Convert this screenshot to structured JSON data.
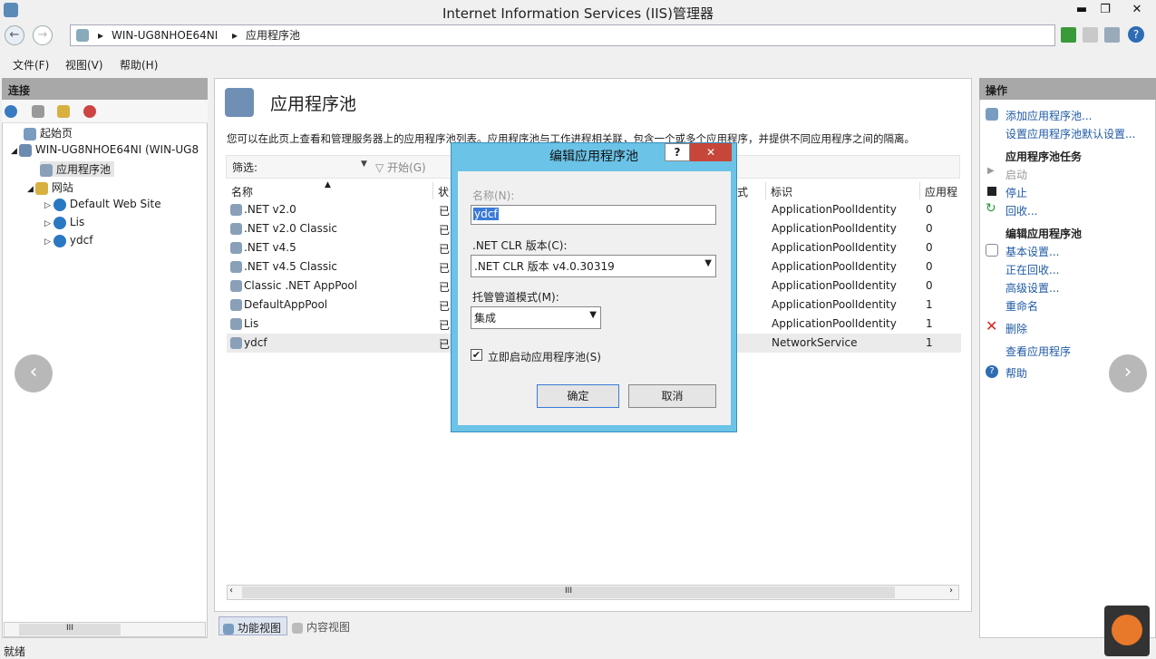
{
  "window": {
    "title": "Internet Information Services (IIS)管理器",
    "min": "▬",
    "max": "❐",
    "close": "✕"
  },
  "address": {
    "server": "WIN-UG8NHOE64NI",
    "page": "应用程序池",
    "sep": "▸"
  },
  "menu": [
    "文件(F)",
    "视图(V)",
    "帮助(H)"
  ],
  "left": {
    "header": "连接",
    "tree": [
      {
        "label": "起始页"
      },
      {
        "label": "WIN-UG8NHOE64NI (WIN-UG8"
      },
      {
        "label": "应用程序池"
      },
      {
        "label": "网站"
      },
      {
        "label": "Default Web Site"
      },
      {
        "label": "Lis"
      },
      {
        "label": "ydcf"
      }
    ],
    "scroll_thumb": "III"
  },
  "center": {
    "title": "应用程序池",
    "desc": "您可以在此页上查看和管理服务器上的应用程序池列表。应用程序池与工作进程相关联，包含一个或多个应用程序，并提供不同应用程序之间的隔离。",
    "filter_label": "筛选:",
    "start_label": "开始(G)",
    "columns": [
      "名称",
      "状",
      "式",
      "标识",
      "应用程"
    ],
    "rows": [
      {
        "name": ".NET v2.0",
        "status": "已",
        "identity": "ApplicationPoolIdentity",
        "apps": "0"
      },
      {
        "name": ".NET v2.0 Classic",
        "status": "已",
        "identity": "ApplicationPoolIdentity",
        "apps": "0"
      },
      {
        "name": ".NET v4.5",
        "status": "已",
        "identity": "ApplicationPoolIdentity",
        "apps": "0"
      },
      {
        "name": ".NET v4.5 Classic",
        "status": "已",
        "identity": "ApplicationPoolIdentity",
        "apps": "0"
      },
      {
        "name": "Classic .NET AppPool",
        "status": "已",
        "identity": "ApplicationPoolIdentity",
        "apps": "0"
      },
      {
        "name": "DefaultAppPool",
        "status": "已",
        "identity": "ApplicationPoolIdentity",
        "apps": "1"
      },
      {
        "name": "Lis",
        "status": "已",
        "identity": "ApplicationPoolIdentity",
        "apps": "1"
      },
      {
        "name": "ydcf",
        "status": "已",
        "identity": "NetworkService",
        "apps": "1"
      }
    ],
    "hscroll": "III",
    "view_feature": "功能视图",
    "view_content": "内容视图"
  },
  "right": {
    "header": "操作",
    "add": "添加应用程序池...",
    "defaults": "设置应用程序池默认设置...",
    "task_title": "应用程序池任务",
    "start": "启动",
    "stop": "停止",
    "recycle": "回收...",
    "edit_title": "编辑应用程序池",
    "basic": "基本设置...",
    "recycling": "正在回收...",
    "advanced": "高级设置...",
    "rename": "重命名",
    "delete": "删除",
    "view_apps": "查看应用程序",
    "help": "帮助"
  },
  "dialog": {
    "title": "编辑应用程序池",
    "help": "?",
    "close": "✕",
    "name_label": "名称(N):",
    "name_value": "ydcf",
    "clr_label": ".NET CLR 版本(C):",
    "clr_value": ".NET CLR 版本 v4.0.30319",
    "pipeline_label": "托管管道模式(M):",
    "pipeline_value": "集成",
    "autostart_label": "立即启动应用程序池(S)",
    "autostart_checked": true,
    "ok": "确定",
    "cancel": "取消"
  },
  "status": "就绪",
  "nav": {
    "back": "‹",
    "forward": "›"
  }
}
